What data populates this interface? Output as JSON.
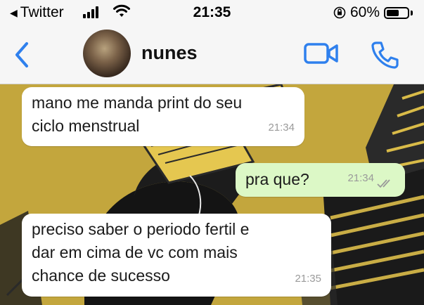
{
  "status_bar": {
    "back_app": "Twitter",
    "time": "21:35",
    "battery_percent": "60%",
    "battery_level": 0.6
  },
  "header": {
    "contact_name": "nunes",
    "icons": {
      "back": "chevron-left-icon",
      "video": "video-camera-icon",
      "call": "phone-icon"
    },
    "accent_color": "#2f80ed"
  },
  "messages": [
    {
      "direction": "incoming",
      "text": "mano me manda print do seu\nciclo menstrual",
      "time": "21:34"
    },
    {
      "direction": "outgoing",
      "text": "pra que?",
      "time": "21:34",
      "status": "delivered"
    },
    {
      "direction": "incoming",
      "text": "preciso saber o periodo fertil e\ndar em cima de vc com mais\nchance de sucesso",
      "time": "21:35"
    }
  ],
  "colors": {
    "incoming_bubble": "#ffffff",
    "outgoing_bubble": "#dcf8c6",
    "wallpaper_base": "#c9ad45"
  }
}
